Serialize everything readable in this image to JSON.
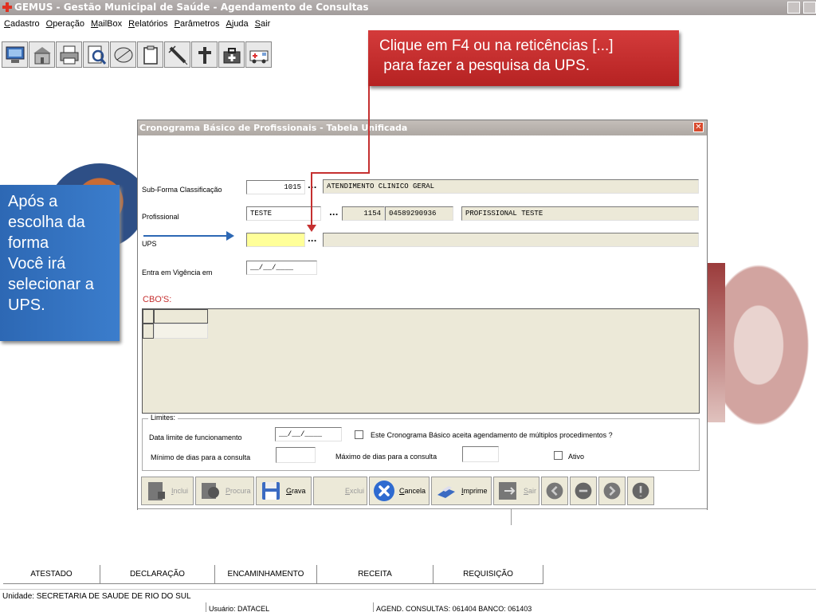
{
  "window": {
    "title": "GEMUS - Gestão Municipal de Saúde - Agendamento de Consultas"
  },
  "menu": [
    "Cadastro",
    "Operação",
    "MailBox",
    "Relatórios",
    "Parâmetros",
    "Ajuda",
    "Sair"
  ],
  "toolbar_icons": [
    "monitor-icon",
    "building-icon",
    "printer-icon",
    "search-doc-icon",
    "pill-icon",
    "clipboard-icon",
    "syringe-icon",
    "cross-icon",
    "medical-bag-icon",
    "ambulance-icon"
  ],
  "callouts": {
    "top": [
      "Clique em F4 ou na reticências [...]",
      " para fazer a pesquisa da UPS."
    ],
    "left": [
      "Após a",
      "escolha da",
      "forma",
      "Você irá",
      "selecionar a",
      "UPS."
    ]
  },
  "dialog": {
    "title": "Cronograma Básico de Profissionais - Tabela Unificada",
    "sub_forma_label": "Sub-Forma Classificação",
    "sub_forma_code": "1015",
    "sub_forma_desc": "ATENDIMENTO CLINICO GERAL",
    "profissional_label": "Profissional",
    "profissional_value": "TESTE",
    "profissional_code": "1154",
    "profissional_cns": "04589290936",
    "profissional_name": "PROFISSIONAL TESTE",
    "ups_label": "UPS",
    "ups_value": "",
    "vigencia_label": "Entra em Vigência em",
    "vigencia_value": "__/__/____",
    "ellipsis": "...",
    "cbo_label": "CBO'S:",
    "limites_label": "Limites:",
    "data_limite_label": "Data limite de funcionamento",
    "data_limite_value": "__/__/____",
    "multiplos_label": "Este Cronograma Básico aceita agendamento de múltiplos procedimentos ?",
    "minimo_label": "Mínimo de dias para  a consulta",
    "maximo_label": "Máximo de dias para a consulta",
    "ativo_label": "Ativo",
    "buttons": {
      "inclui": "Inclui",
      "procura": "Procura",
      "grava": "Grava",
      "exclui": "Exclui",
      "cancela": "Cancela",
      "imprime": "Imprime",
      "sair": "Sair"
    }
  },
  "tabs": [
    "ATESTADO",
    "DECLARAÇÃO",
    "ENCAMINHAMENTO",
    "RECEITA",
    "REQUISIÇÃO"
  ],
  "status": {
    "unidade": "Unidade: SECRETARIA DE SAUDE DE RIO DO SUL",
    "usuario": "Usuário: DATACEL",
    "agend": "AGEND. CONSULTAS: 061404 BANCO: 061403"
  },
  "colors": {
    "callout_red": "#c53030",
    "callout_blue": "#2d68b4",
    "ups_highlight": "#ffff99"
  }
}
